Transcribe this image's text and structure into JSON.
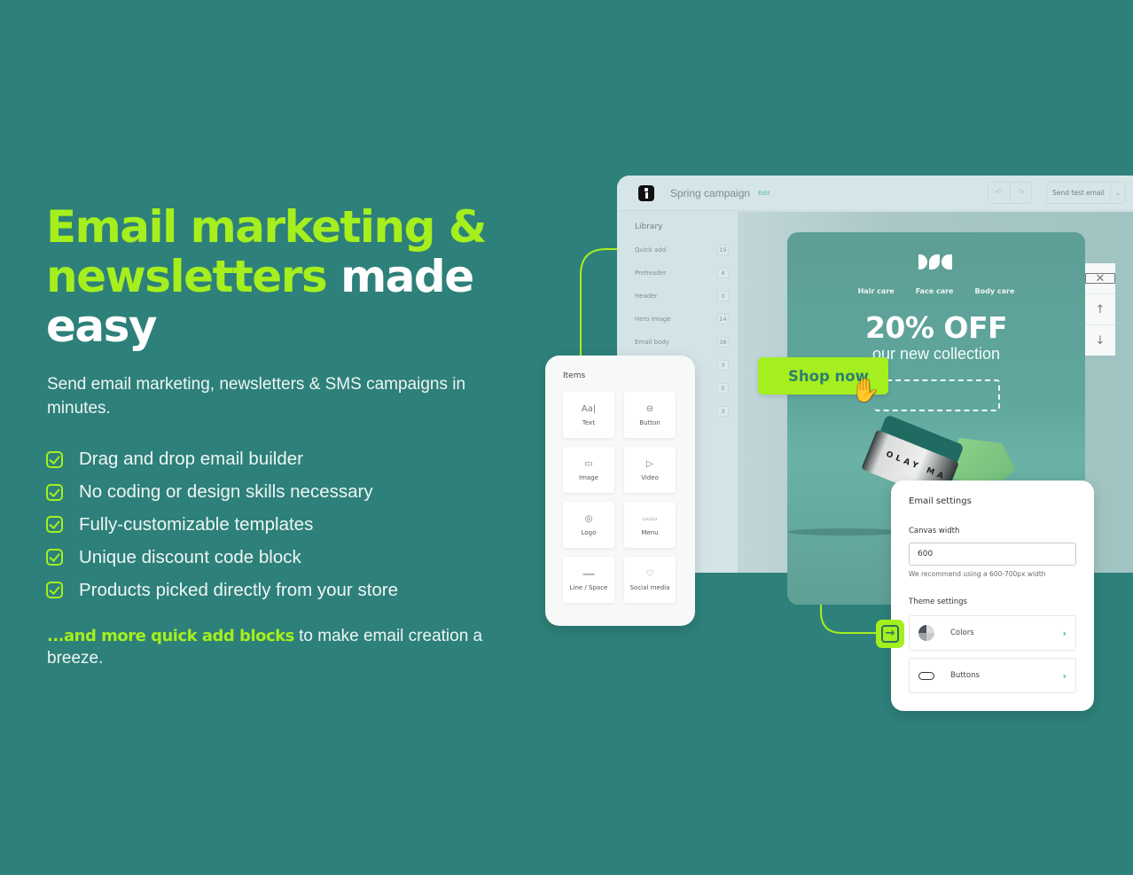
{
  "colors": {
    "background": "#2e807a",
    "accent": "#a5ef1e",
    "text": "#ffffff"
  },
  "hero": {
    "headline_green_1": "Email marketing &",
    "headline_green_2": "newsletters",
    "headline_white_1": " made",
    "headline_white_2": "easy",
    "subhead": "Send email marketing, newsletters & SMS campaigns in minutes.",
    "features": [
      "Drag and drop email builder",
      "No coding or design skills necessary",
      "Fully-customizable templates",
      "Unique discount code block",
      "Products picked directly from your store"
    ],
    "more_bold": "...and more quick add blocks",
    "more_rest": " to make email creation a breeze."
  },
  "app": {
    "campaign_name": "Spring campaign",
    "edit_label": "Edit",
    "undo_icon": "↶",
    "redo_icon": "↷",
    "send_test_label": "Send test email",
    "send_caret": "⌄",
    "library": {
      "title": "Library",
      "rows": [
        {
          "label": "Quick add",
          "count": "15"
        },
        {
          "label": "Preheader",
          "count": "4"
        },
        {
          "label": "Header",
          "count": "3"
        },
        {
          "label": "Hero image",
          "count": "14"
        },
        {
          "label": "Email body",
          "count": "38"
        },
        {
          "label": "",
          "count": "3"
        },
        {
          "label": "",
          "count": "5"
        },
        {
          "label": "",
          "count": "3"
        }
      ]
    }
  },
  "email_preview": {
    "nav": [
      "Hair care",
      "Face care",
      "Body care"
    ],
    "headline": "20% OFF",
    "subline": "our new collection",
    "cta": "Shop now",
    "product_label": "OLAY MA"
  },
  "side_tools": {
    "delete": "✕",
    "up": "↑",
    "down": "↓"
  },
  "items_panel": {
    "title": "Items",
    "tiles": [
      {
        "icon": "Aa|",
        "label": "Text"
      },
      {
        "icon": "⊖",
        "label": "Button"
      },
      {
        "icon": "▭",
        "label": "Image"
      },
      {
        "icon": "▷",
        "label": "Video"
      },
      {
        "icon": "◎",
        "label": "Logo"
      },
      {
        "icon": "▭▭▭",
        "label": "Menu"
      },
      {
        "icon": "═══",
        "label": "Line / Space"
      },
      {
        "icon": "♡",
        "label": "Social media"
      }
    ]
  },
  "settings": {
    "title": "Email settings",
    "canvas_width_label": "Canvas width",
    "canvas_width_value": "600",
    "hint": "We recommend using a 600-700px width",
    "theme_label": "Theme settings",
    "rows": [
      {
        "label": "Colors",
        "chev": "›"
      },
      {
        "label": "Buttons",
        "chev": "›"
      }
    ]
  },
  "connector_icon": "→"
}
